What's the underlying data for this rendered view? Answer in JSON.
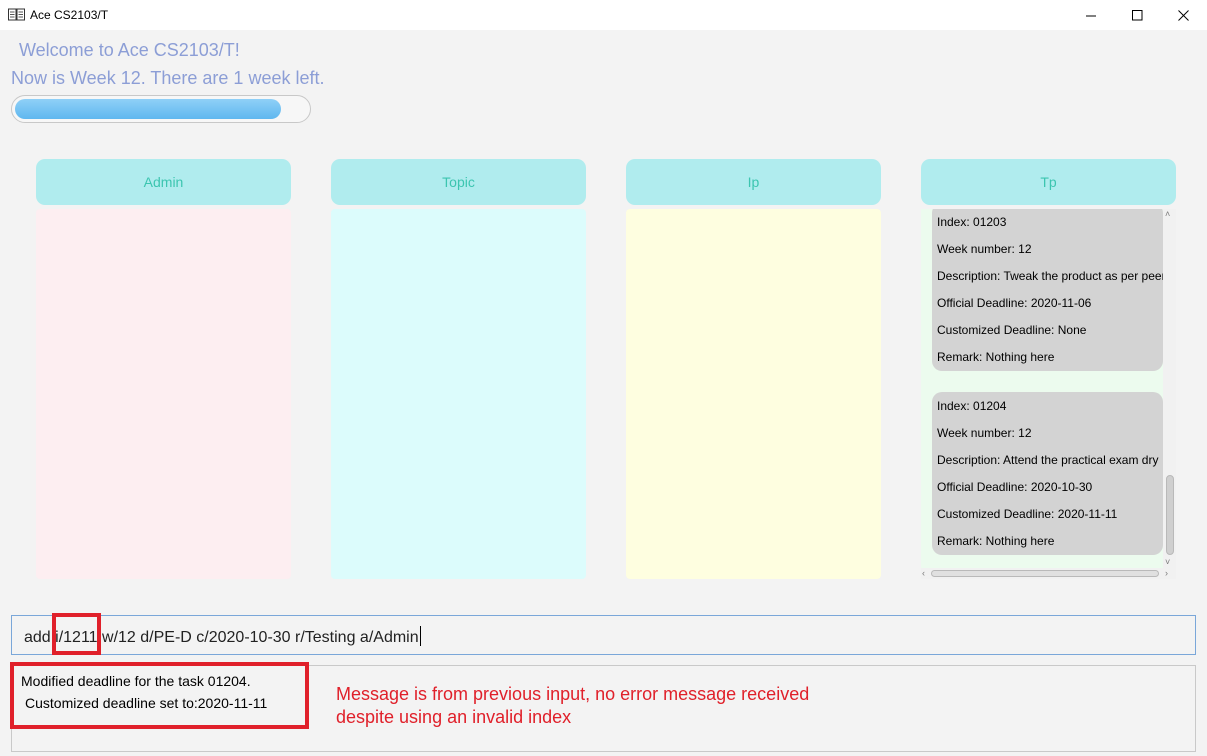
{
  "window": {
    "title": "Ace CS2103/T"
  },
  "header": {
    "welcome": "Welcome to Ace CS2103/T!",
    "week_status": "Now is Week 12. There are 1 week left.",
    "progress": 0.91
  },
  "columns": [
    {
      "title": "Admin",
      "color": "#fdeef1"
    },
    {
      "title": "Topic",
      "color": "#dcfcfc"
    },
    {
      "title": "Ip",
      "color": "#fefee0"
    },
    {
      "title": "Tp",
      "color": "#ecfbee"
    }
  ],
  "tp_tasks": [
    {
      "index": "Index: 01203",
      "week": "Week number: 12",
      "description": "Description: Tweak the product as per peer",
      "official": "Official Deadline: 2020-11-06",
      "customized": "Customized Deadline: None",
      "remark": "Remark: Nothing here"
    },
    {
      "index": "Index: 01204",
      "week": "Week number: 12",
      "description": "Description: Attend the practical exam dry",
      "official": "Official Deadline: 2020-10-30",
      "customized": "Customized Deadline: 2020-11-11",
      "remark": "Remark: Nothing here"
    }
  ],
  "command": {
    "prefix": "add",
    "highlighted": "i/1211",
    "rest": "w/12 d/PE-D c/2020-10-30 r/Testing a/Admin"
  },
  "result": {
    "line1": "Modified deadline for the task 01204.",
    "line2": "Customized deadline set to:2020-11-11"
  },
  "annotation": {
    "text": "Message is from previous input, no error message received\ndespite using an invalid index",
    "color": "#e0202a"
  }
}
